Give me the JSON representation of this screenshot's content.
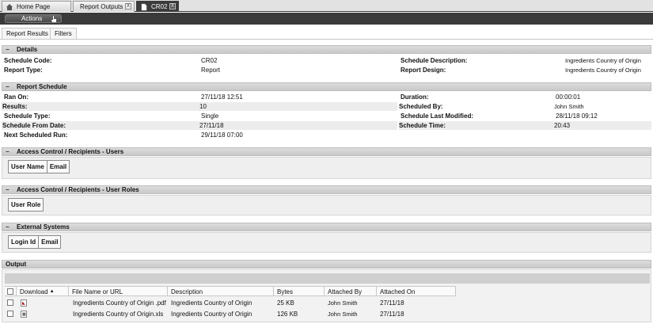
{
  "tabs": [
    {
      "label": "Home Page",
      "icon": "home-icon",
      "closable": false
    },
    {
      "label": "Report Outputs",
      "icon": "",
      "closable": true
    },
    {
      "label": "CR02",
      "icon": "document-icon",
      "closable": true,
      "active": true
    }
  ],
  "close_glyph": "X",
  "toolbar": {
    "actions_label": "Actions",
    "actions_icon": "hand-pointer-icon"
  },
  "subtabs": [
    "Report Results",
    "Filters"
  ],
  "details": {
    "title": "Details",
    "schedule_code_label": "Schedule Code:",
    "schedule_code": "CR02",
    "report_type_label": "Report Type:",
    "report_type": "Report",
    "schedule_description_label": "Schedule Description:",
    "schedule_description": "Ingredients Country of Origin",
    "report_design_label": "Report Design:",
    "report_design": "Ingredients Country of Origin"
  },
  "schedule": {
    "title": "Report Schedule",
    "ran_on_label": "Ran On:",
    "ran_on": "27/11/18 12:51",
    "results_label": "Results:",
    "results": "10",
    "schedule_type_label": "Schedule Type:",
    "schedule_type": "Single",
    "schedule_from_label": "Schedule From Date:",
    "schedule_from": "27/11/18",
    "next_run_label": "Next Scheduled Run:",
    "next_run": "29/11/18 07:00",
    "duration_label": "Duration:",
    "duration": "00:00:01",
    "scheduled_by_label": "Scheduled By:",
    "scheduled_by": "John Smith",
    "last_modified_label": "Schedule Last Modified:",
    "last_modified": "28/11/18 09:12",
    "schedule_time_label": "Schedule Time:",
    "schedule_time": "20:43"
  },
  "users": {
    "title": "Access Control / Recipients - Users",
    "columns": [
      "User Name",
      "Email"
    ]
  },
  "roles": {
    "title": "Access Control / Recipients - User Roles",
    "columns": [
      "User Role"
    ]
  },
  "external": {
    "title": "External Systems",
    "columns": [
      "Login Id",
      "Email"
    ]
  },
  "output": {
    "title": "Output",
    "columns": [
      "Download",
      "File Name or URL",
      "Description",
      "Bytes",
      "Attached By",
      "Attached On"
    ],
    "sort_indicator": "▲",
    "rows": [
      {
        "type": "pdf",
        "file": "Ingredients Country of Origin .pdf",
        "description": "Ingredients Country of Origin",
        "bytes": "25 KB",
        "attached_by": "John Smith",
        "attached_on": "27/11/18"
      },
      {
        "type": "xls",
        "file": "Ingredients Country of Origin.xls",
        "description": "Ingredients Country of Origin",
        "bytes": "126 KB",
        "attached_by": "John Smith",
        "attached_on": "27/11/18"
      }
    ]
  },
  "collapse_glyph": "−"
}
